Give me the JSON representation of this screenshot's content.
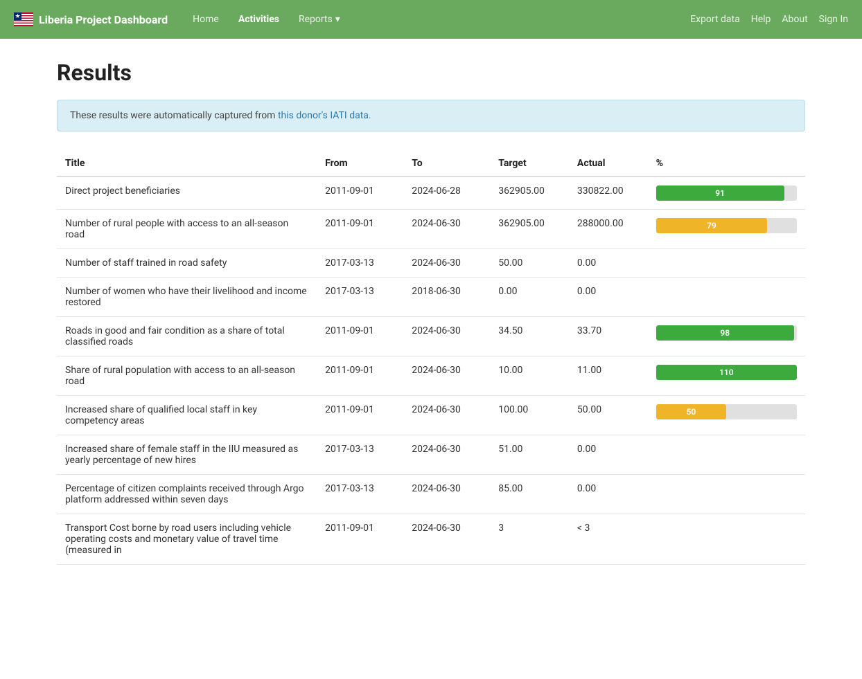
{
  "navbar": {
    "brand": "Liberia Project Dashboard",
    "links": [
      {
        "label": "Home",
        "active": false
      },
      {
        "label": "Activities",
        "active": true
      },
      {
        "label": "Reports",
        "active": false,
        "hasDropdown": true
      }
    ],
    "right_links": [
      {
        "label": "Export data"
      },
      {
        "label": "Help"
      },
      {
        "label": "About"
      },
      {
        "label": "Sign In"
      }
    ]
  },
  "page": {
    "title": "Results",
    "banner_text": "These results were automatically captured from ",
    "banner_link_text": "this donor's IATI data.",
    "banner_link_href": "#"
  },
  "table": {
    "headers": [
      "Title",
      "From",
      "To",
      "Target",
      "Actual",
      "%"
    ],
    "rows": [
      {
        "title": "Direct project beneficiaries",
        "from": "2011-09-01",
        "to": "2024-06-28",
        "target": "362905.00",
        "actual": "330822.00",
        "percent": 91,
        "bar_color": "green"
      },
      {
        "title": "Number of rural people with access to an all-season road",
        "from": "2011-09-01",
        "to": "2024-06-30",
        "target": "362905.00",
        "actual": "288000.00",
        "percent": 79,
        "bar_color": "yellow"
      },
      {
        "title": "Number of staff trained in road safety",
        "from": "2017-03-13",
        "to": "2024-06-30",
        "target": "50.00",
        "actual": "0.00",
        "percent": null,
        "bar_color": null
      },
      {
        "title": "Number of women who have their livelihood and income restored",
        "from": "2017-03-13",
        "to": "2018-06-30",
        "target": "0.00",
        "actual": "0.00",
        "percent": null,
        "bar_color": null
      },
      {
        "title": "Roads in good and fair condition as a share of total classified roads",
        "from": "2011-09-01",
        "to": "2024-06-30",
        "target": "34.50",
        "actual": "33.70",
        "percent": 98,
        "bar_color": "green"
      },
      {
        "title": "Share of rural population with access to an all-season road",
        "from": "2011-09-01",
        "to": "2024-06-30",
        "target": "10.00",
        "actual": "11.00",
        "percent": 110,
        "bar_color": "green"
      },
      {
        "title": "Increased share of qualified local staff in key competency areas",
        "from": "2011-09-01",
        "to": "2024-06-30",
        "target": "100.00",
        "actual": "50.00",
        "percent": 50,
        "bar_color": "yellow"
      },
      {
        "title": "Increased share of female staff in the IIU measured as yearly percentage of new hires",
        "from": "2017-03-13",
        "to": "2024-06-30",
        "target": "51.00",
        "actual": "0.00",
        "percent": null,
        "bar_color": null
      },
      {
        "title": "Percentage of citizen complaints received through Argo platform addressed within seven days",
        "from": "2017-03-13",
        "to": "2024-06-30",
        "target": "85.00",
        "actual": "0.00",
        "percent": null,
        "bar_color": null
      },
      {
        "title": "Transport Cost borne by road users including vehicle operating costs and monetary value of travel time (measured in",
        "from": "2011-09-01",
        "to": "2024-06-30",
        "target": "3",
        "actual": "< 3",
        "percent": null,
        "bar_color": null
      }
    ]
  }
}
